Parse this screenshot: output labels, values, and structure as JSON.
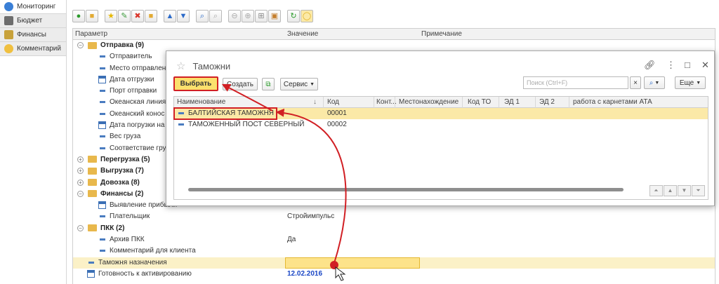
{
  "nav": {
    "items": [
      {
        "label": "Мониторинг",
        "icon": "globe-icon",
        "color": "#3a7fd6"
      },
      {
        "label": "Бюджет",
        "icon": "calculator-icon",
        "color": "#6d6d6d"
      },
      {
        "label": "Финансы",
        "icon": "money-icon",
        "color": "#c8a23b"
      },
      {
        "label": "Комментарий",
        "icon": "comment-icon",
        "color": "#f0c040"
      }
    ]
  },
  "table": {
    "headers": {
      "param": "Параметр",
      "value": "Значение",
      "note": "Примечание"
    },
    "rows": [
      {
        "label": "Отправка (9)",
        "kind": "group",
        "expanded": true,
        "value": ""
      },
      {
        "label": "Отправитель",
        "kind": "dash",
        "value": ""
      },
      {
        "label": "Место отправлени",
        "kind": "dash",
        "value": ""
      },
      {
        "label": "Дата отгрузки",
        "kind": "date",
        "value": ""
      },
      {
        "label": "Порт отправки",
        "kind": "dash",
        "value": ""
      },
      {
        "label": "Океанская линия",
        "kind": "dash",
        "value": ""
      },
      {
        "label": "Океанский конос",
        "kind": "dash",
        "value": ""
      },
      {
        "label": "Дата погрузки на",
        "kind": "date",
        "value": ""
      },
      {
        "label": "Вес груза",
        "kind": "dash",
        "value": ""
      },
      {
        "label": "Соответствие гру",
        "kind": "dash",
        "value": ""
      },
      {
        "label": "Перегрузка (5)",
        "kind": "group",
        "expanded": false,
        "value": ""
      },
      {
        "label": "Выгрузка (7)",
        "kind": "group",
        "expanded": false,
        "value": ""
      },
      {
        "label": "Довозка (8)",
        "kind": "group",
        "expanded": false,
        "value": ""
      },
      {
        "label": "Финансы (2)",
        "kind": "group",
        "expanded": true,
        "value": ""
      },
      {
        "label": "Выявление прибыли",
        "kind": "date",
        "value": ""
      },
      {
        "label": "Плательщик",
        "kind": "dash",
        "value": "Стройимпульс"
      },
      {
        "label": "ПКК (2)",
        "kind": "group",
        "expanded": true,
        "value": ""
      },
      {
        "label": "Архив ПКК",
        "kind": "dash",
        "value": "Да"
      },
      {
        "label": "Комментарий для клиента",
        "kind": "dash",
        "value": ""
      },
      {
        "label": "Таможня назначения",
        "kind": "dash-root",
        "value": ""
      },
      {
        "label": "Готовность к активированию",
        "kind": "date-root",
        "value": "12.02.2016"
      }
    ]
  },
  "dialog": {
    "title": "Таможни",
    "select_label": "Выбрать",
    "create_label": "Создать",
    "service_label": "Сервис",
    "search_placeholder": "Поиск (Ctrl+F)",
    "more_label": "Еще",
    "columns": [
      "Наименование",
      "Код",
      "Конт...",
      "Местонахождение",
      "Код ТО",
      "ЭД 1",
      "ЭД 2",
      "работа с карнетами АТА"
    ],
    "rows": [
      {
        "name": "БАЛТИЙСКАЯ ТАМОЖНЯ",
        "code": "00001",
        "selected": true
      },
      {
        "name": "ТАМОЖЕННЫЙ ПОСТ СЕВЕРНЫЙ",
        "code": "00002",
        "selected": false
      }
    ]
  },
  "colors": {
    "accent": "#fbe06d",
    "callout": "#d11f24",
    "selection": "#fbe9a7"
  }
}
